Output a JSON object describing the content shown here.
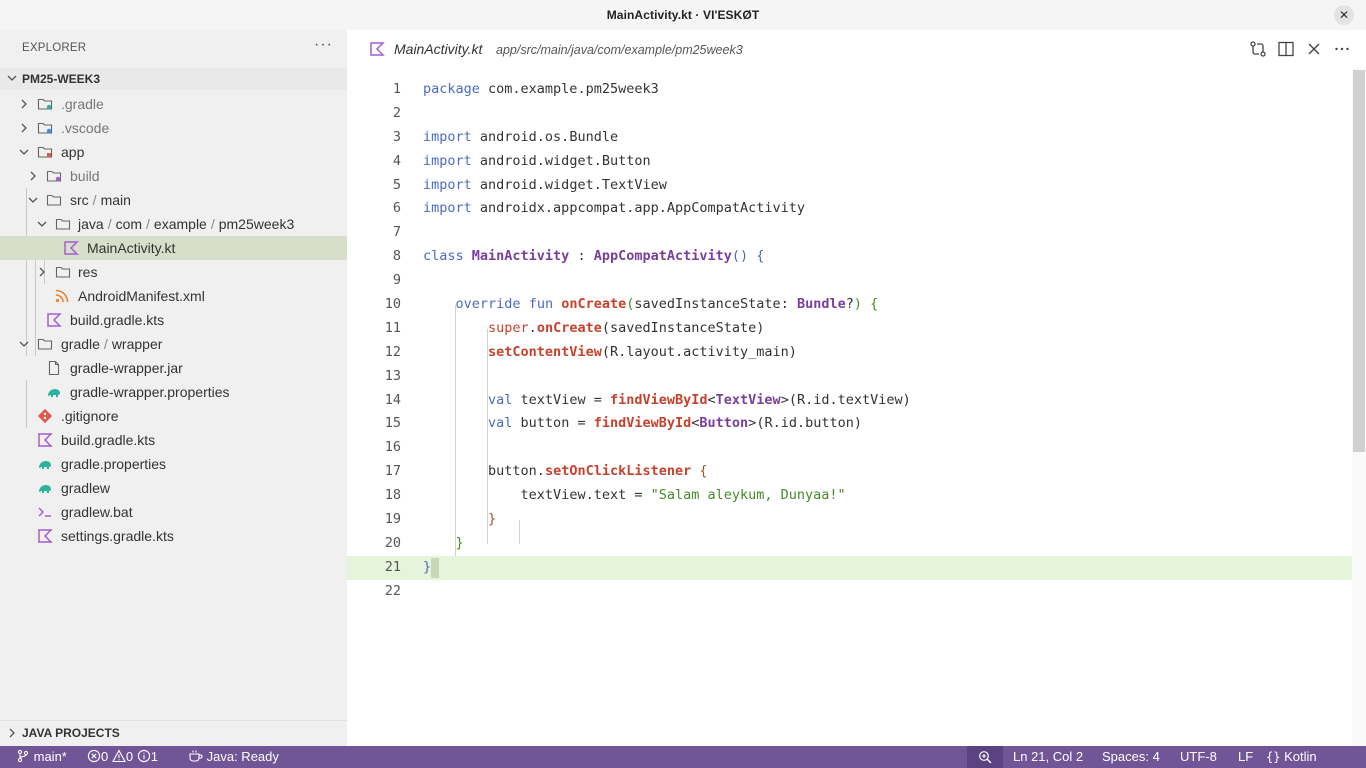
{
  "window": {
    "title": "MainActivity.kt · VI'ESKØT"
  },
  "sidebar": {
    "header": "EXPLORER",
    "project": "PM25-WEEK3",
    "tree": [
      {
        "label": ".gradle"
      },
      {
        "label": ".vscode"
      },
      {
        "label": "app"
      },
      {
        "label": "build"
      },
      {
        "parts": [
          "src",
          "main"
        ]
      },
      {
        "parts": [
          "java",
          "com",
          "example",
          "pm25week3"
        ]
      },
      {
        "label": "MainActivity.kt"
      },
      {
        "label": "res"
      },
      {
        "label": "AndroidManifest.xml"
      },
      {
        "label": "build.gradle.kts"
      },
      {
        "parts": [
          "gradle",
          "wrapper"
        ]
      },
      {
        "label": "gradle-wrapper.jar"
      },
      {
        "label": "gradle-wrapper.properties"
      },
      {
        "label": ".gitignore"
      },
      {
        "label": "build.gradle.kts"
      },
      {
        "label": "gradle.properties"
      },
      {
        "label": "gradlew"
      },
      {
        "label": "gradlew.bat"
      },
      {
        "label": "settings.gradle.kts"
      }
    ],
    "path_separator": "/",
    "java_projects": "JAVA PROJECTS"
  },
  "editor": {
    "tab_file": "MainActivity.kt",
    "tab_path": "app/src/main/java/com/example/pm25week3",
    "line_numbers": [
      "1",
      "2",
      "3",
      "4",
      "5",
      "6",
      "7",
      "8",
      "9",
      "10",
      "11",
      "12",
      "13",
      "14",
      "15",
      "16",
      "17",
      "18",
      "19",
      "20",
      "21",
      "22"
    ],
    "code": {
      "l1_kw": "package",
      "l1_rest": " com.example.pm25week3",
      "import_kw": "import",
      "l3": " android.os.Bundle",
      "l4": " android.widget.Button",
      "l5": " android.widget.TextView",
      "l6": " androidx.appcompat.app.AppCompatActivity",
      "l8_kw": "class",
      "l8_name": "MainActivity",
      "l8_colon": " : ",
      "l8_super": "AppCompatActivity",
      "l8_paren": "()",
      "l8_brace": " {",
      "l10_override": "override",
      "l10_fun": "fun",
      "l10_name": "onCreate",
      "l10_open": "(",
      "l10_param": "savedInstanceState: ",
      "l10_type": "Bundle",
      "l10_q": "?",
      "l10_close": ")",
      "l10_brace": " {",
      "l11_super": "super",
      "l11_dot": ".",
      "l11_call": "onCreate",
      "l11_args": "(savedInstanceState)",
      "l12_call": "setContentView",
      "l12_args": "(R.layout.activity_main)",
      "val_kw": "val",
      "l14_name": " textView = ",
      "l14_call": "findViewById",
      "l14_lt": "<",
      "l14_type": "TextView",
      "l14_gt": ">",
      "l14_args": "(R.id.textView)",
      "l15_name": " button = ",
      "l15_call": "findViewById",
      "l15_lt": "<",
      "l15_type": "Button",
      "l15_gt": ">",
      "l15_args": "(R.id.button)",
      "l17_obj": "button.",
      "l17_call": "setOnClickListener",
      "l17_brace": " {",
      "l18_lhs": "textView.text = ",
      "l18_str": "\"Salam aleykum, Dunyaa!\"",
      "l19": "}",
      "l20": "}",
      "l21": "}"
    }
  },
  "status": {
    "branch": "main*",
    "errors": "0",
    "warnings": "0",
    "info": "1",
    "java": "Java: Ready",
    "position": "Ln 21, Col 2",
    "spaces": "Spaces: 4",
    "encoding": "UTF-8",
    "eol": "LF",
    "language": "Kotlin"
  },
  "colors": {
    "statusbar": "#705697",
    "selection": "#d7dfca",
    "current_line": "#e6f4da",
    "kotlin_icon": "#a35fd1",
    "gradle_icon": "#2bb3a0",
    "git_icon": "#e0584b",
    "xml_icon": "#e8832e"
  }
}
